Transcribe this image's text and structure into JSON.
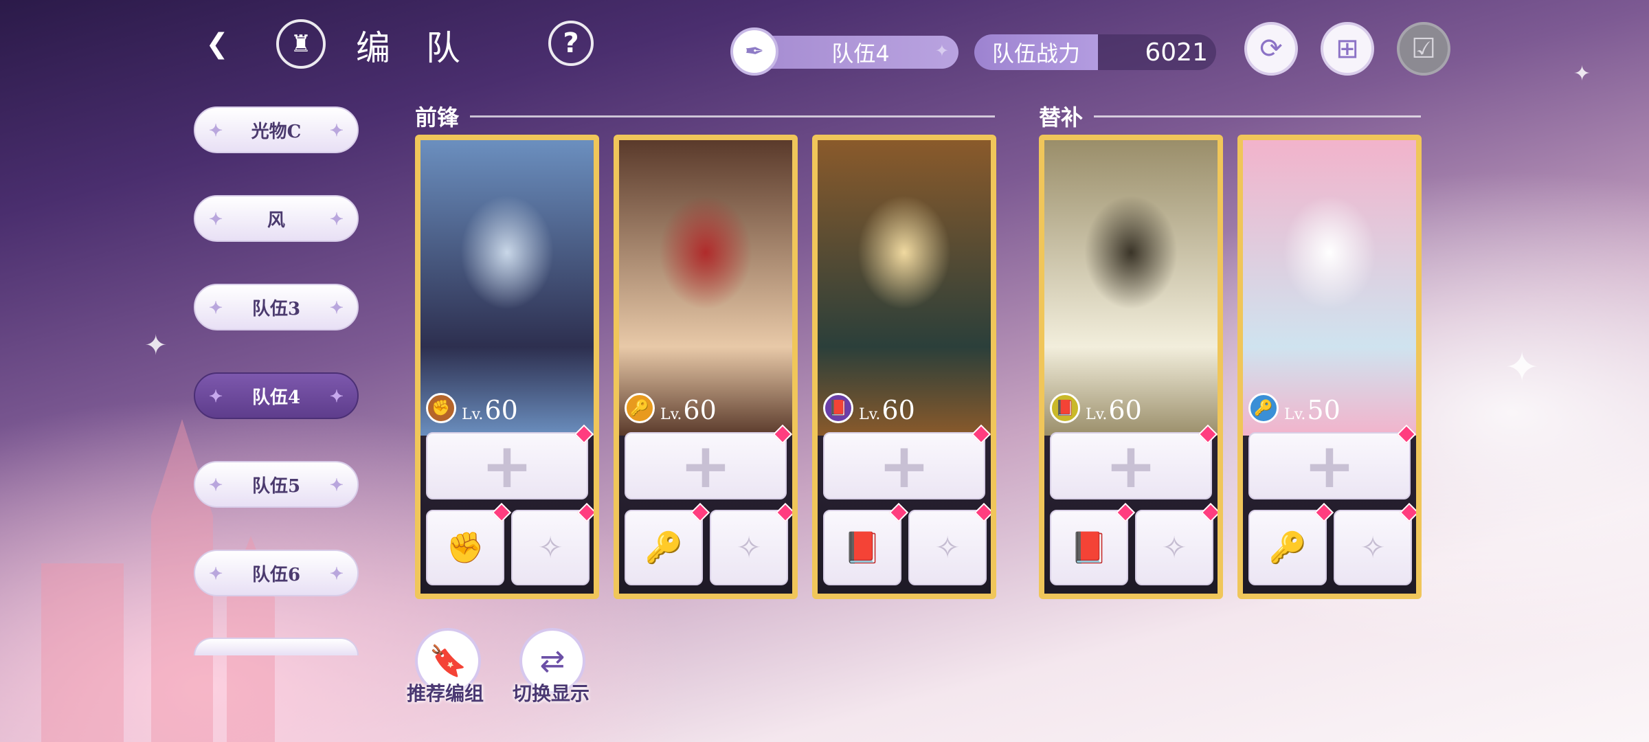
{
  "header": {
    "title": "编 队",
    "back_icon": "back-arrow-icon",
    "home_icon": "castle-icon",
    "help_label": "?"
  },
  "team_selector": {
    "current_team": "队伍4",
    "icon": "feather-icon"
  },
  "power": {
    "label": "队伍战力",
    "value": "6021"
  },
  "toolbar": {
    "refresh_icon": "refresh-icon",
    "copy_icon": "copy-add-icon",
    "confirm_icon": "checklist-icon"
  },
  "sidebar": {
    "teams": [
      {
        "label": "光物C",
        "active": false
      },
      {
        "label": "风",
        "active": false
      },
      {
        "label": "队伍3",
        "active": false
      },
      {
        "label": "队伍4",
        "active": true
      },
      {
        "label": "队伍5",
        "active": false
      },
      {
        "label": "队伍6",
        "active": false
      }
    ]
  },
  "sections": {
    "frontline": "前锋",
    "substitute": "替补"
  },
  "lv_prefix": "Lv.",
  "characters": [
    {
      "level": "60",
      "class_icon": "fist-icon",
      "class_color": "#b5652a",
      "slot_icons": [
        "fist-icon",
        "charm-icon"
      ],
      "palette": [
        "#6b8fbf",
        "#2d2f4f",
        "#c9d7e8"
      ]
    },
    {
      "level": "60",
      "class_icon": "key-icon",
      "class_color": "#e89a1e",
      "slot_icons": [
        "key-icon",
        "charm-icon"
      ],
      "palette": [
        "#5a3a2b",
        "#e8c9a8",
        "#b02b2b"
      ]
    },
    {
      "level": "60",
      "class_icon": "book-icon",
      "class_color": "#6b3fa8",
      "slot_icons": [
        "book-icon",
        "charm-icon"
      ],
      "palette": [
        "#8a5a2b",
        "#2b3f3a",
        "#f0d9a0"
      ]
    },
    {
      "level": "60",
      "class_icon": "book-icon",
      "class_color": "#c9b92a",
      "slot_icons": [
        "book-icon",
        "charm-icon"
      ],
      "palette": [
        "#9a8e6a",
        "#f2eedc",
        "#3a3428"
      ]
    },
    {
      "level": "50",
      "class_icon": "key-icon",
      "class_color": "#3a8fd6",
      "slot_icons": [
        "key-icon",
        "charm-icon"
      ],
      "palette": [
        "#f2b3cb",
        "#cfe3ef",
        "#ffffff"
      ]
    }
  ],
  "actions": [
    {
      "label": "推荐编组",
      "icon": "bookmark-star-icon"
    },
    {
      "label": "切换显示",
      "icon": "swap-arrows-icon"
    }
  ]
}
